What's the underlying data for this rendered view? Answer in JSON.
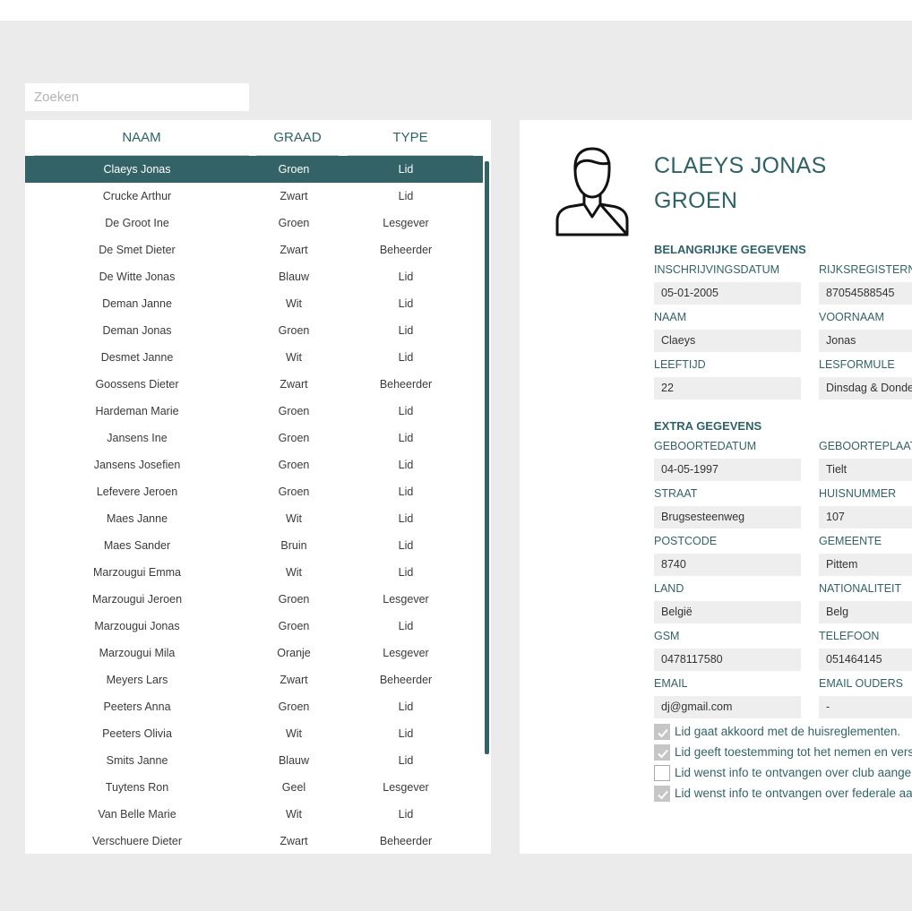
{
  "search": {
    "placeholder": "Zoeken",
    "value": ""
  },
  "list": {
    "columns": [
      "NAAM",
      "GRAAD",
      "TYPE"
    ],
    "rows": [
      {
        "naam": "Claeys Jonas",
        "graad": "Groen",
        "type": "Lid",
        "selected": true
      },
      {
        "naam": "Crucke Arthur",
        "graad": "Zwart",
        "type": "Lid"
      },
      {
        "naam": "De Groot Ine",
        "graad": "Groen",
        "type": "Lesgever"
      },
      {
        "naam": "De Smet Dieter",
        "graad": "Zwart",
        "type": "Beheerder"
      },
      {
        "naam": "De Witte Jonas",
        "graad": "Blauw",
        "type": "Lid"
      },
      {
        "naam": "Deman Janne",
        "graad": "Wit",
        "type": "Lid"
      },
      {
        "naam": "Deman Jonas",
        "graad": "Groen",
        "type": "Lid"
      },
      {
        "naam": "Desmet Janne",
        "graad": "Wit",
        "type": "Lid"
      },
      {
        "naam": "Goossens Dieter",
        "graad": "Zwart",
        "type": "Beheerder"
      },
      {
        "naam": "Hardeman Marie",
        "graad": "Groen",
        "type": "Lid"
      },
      {
        "naam": "Jansens Ine",
        "graad": "Groen",
        "type": "Lid"
      },
      {
        "naam": "Jansens Josefien",
        "graad": "Groen",
        "type": "Lid"
      },
      {
        "naam": "Lefevere Jeroen",
        "graad": "Groen",
        "type": "Lid"
      },
      {
        "naam": "Maes Janne",
        "graad": "Wit",
        "type": "Lid"
      },
      {
        "naam": "Maes Sander",
        "graad": "Bruin",
        "type": "Lid"
      },
      {
        "naam": "Marzougui Emma",
        "graad": "Wit",
        "type": "Lid"
      },
      {
        "naam": "Marzougui Jeroen",
        "graad": "Groen",
        "type": "Lesgever"
      },
      {
        "naam": "Marzougui Jonas",
        "graad": "Groen",
        "type": "Lid"
      },
      {
        "naam": "Marzougui Mila",
        "graad": "Oranje",
        "type": "Lesgever"
      },
      {
        "naam": "Meyers Lars",
        "graad": "Zwart",
        "type": "Beheerder"
      },
      {
        "naam": "Peeters Anna",
        "graad": "Groen",
        "type": "Lid"
      },
      {
        "naam": "Peeters Olivia",
        "graad": "Wit",
        "type": "Lid"
      },
      {
        "naam": "Smits Janne",
        "graad": "Blauw",
        "type": "Lid"
      },
      {
        "naam": "Tuytens Ron",
        "graad": "Geel",
        "type": "Lesgever"
      },
      {
        "naam": "Van Belle Marie",
        "graad": "Wit",
        "type": "Lid"
      },
      {
        "naam": "Verschuere Dieter",
        "graad": "Zwart",
        "type": "Beheerder"
      }
    ]
  },
  "detail": {
    "avatar_icon": "user-icon",
    "name": "CLAEYS JONAS",
    "grade": "GROEN",
    "section1_title": "BELANGRIJKE GEGEVENS",
    "section2_title": "EXTRA GEGEVENS",
    "fields": {
      "inschrijvingsdatum": {
        "label": "INSCHRIJVINGSDATUM",
        "value": "05-01-2005"
      },
      "rijksregisternummer": {
        "label": "RIJKSREGISTERNU",
        "value": "87054588545"
      },
      "naam": {
        "label": "NAAM",
        "value": "Claeys"
      },
      "voornaam": {
        "label": "VOORNAAM",
        "value": "Jonas"
      },
      "leeftijd": {
        "label": "LEEFTIJD",
        "value": "22"
      },
      "lesformule": {
        "label": "LESFORMULE",
        "value": "Dinsdag & Donde"
      },
      "geboortedatum": {
        "label": "GEBOORTEDATUM",
        "value": "04-05-1997"
      },
      "geboorteplaats": {
        "label": "GEBOORTEPLAATS",
        "value": "Tielt"
      },
      "straat": {
        "label": "STRAAT",
        "value": "Brugsesteenweg"
      },
      "huisnummer": {
        "label": "HUISNUMMER",
        "value": "107"
      },
      "postcode": {
        "label": "POSTCODE",
        "value": "8740"
      },
      "gemeente": {
        "label": "GEMEENTE",
        "value": "Pittem"
      },
      "land": {
        "label": "LAND",
        "value": "België"
      },
      "nationaliteit": {
        "label": "NATIONALITEIT",
        "value": "Belg"
      },
      "gsm": {
        "label": "GSM",
        "value": "0478117580"
      },
      "telefoon": {
        "label": "TELEFOON",
        "value": "051464145"
      },
      "email": {
        "label": "EMAIL",
        "value": "dj@gmail.com"
      },
      "email_ouders": {
        "label": "EMAIL OUDERS",
        "value": "-"
      }
    },
    "checks": [
      {
        "label": "Lid gaat akkoord met de huisreglementen.",
        "checked": true
      },
      {
        "label": "Lid geeft toestemming tot het nemen en versp",
        "checked": true
      },
      {
        "label": "Lid wenst info te ontvangen over club aangele",
        "checked": false
      },
      {
        "label": "Lid wenst info te ontvangen over federale aang",
        "checked": true
      }
    ]
  },
  "colors": {
    "accent": "#336366",
    "background": "#ebebeb",
    "field_bg": "#eeeeee"
  }
}
